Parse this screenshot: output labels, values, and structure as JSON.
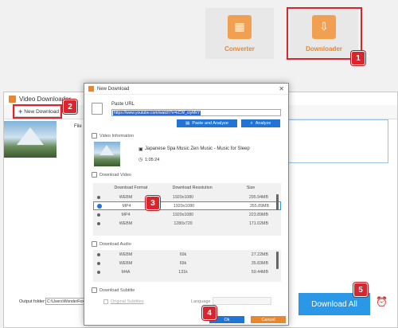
{
  "tiles": {
    "converter": "Converter",
    "downloader": "Downloader"
  },
  "badges": [
    "1",
    "2",
    "3",
    "4",
    "5"
  ],
  "main_window": {
    "title": "Video Downloader",
    "new_download": "New Download",
    "file_label": "File",
    "output_label": "Output folder:",
    "output_path": "C:\\Users\\WonderFox\\",
    "download_all": "Download All"
  },
  "dialog": {
    "title": "New Download",
    "paste_url_label": "Paste URL",
    "url_value": "https://www.youtube.com/watch?v=kCW_ctyMkY",
    "paste_analyze": "Paste and Analyze",
    "analyze": "Analyze",
    "video_info_label": "Video Information",
    "video_title": "Japanese Spa Music Zen Music - Music for Sleep",
    "duration": "1:05:24",
    "download_video_label": "Download Video",
    "video_headers": [
      "Download Format",
      "Download Resolution",
      "Size"
    ],
    "video_rows": [
      {
        "format": "WEBM",
        "res": "1920x1080",
        "size": "295.94MB",
        "selected": false
      },
      {
        "format": "MP4",
        "res": "1920x1080",
        "size": "355.89MB",
        "selected": true
      },
      {
        "format": "MP4",
        "res": "1920x1080",
        "size": "223.89MB",
        "selected": false
      },
      {
        "format": "WEBM",
        "res": "1280x720",
        "size": "171.02MB",
        "selected": false
      }
    ],
    "download_audio_label": "Download Audio",
    "audio_rows": [
      {
        "format": "WEBM",
        "res": "69k",
        "size": "27.22MB"
      },
      {
        "format": "WEBM",
        "res": "69k",
        "size": "35.83MB"
      },
      {
        "format": "M4A",
        "res": "131k",
        "size": "59.44MB"
      }
    ],
    "download_subtitle_label": "Download Subtitle",
    "original_subtitles": "Original Subtitles",
    "language_label": "Language",
    "ok": "Ok",
    "cancel": "Cancel"
  }
}
